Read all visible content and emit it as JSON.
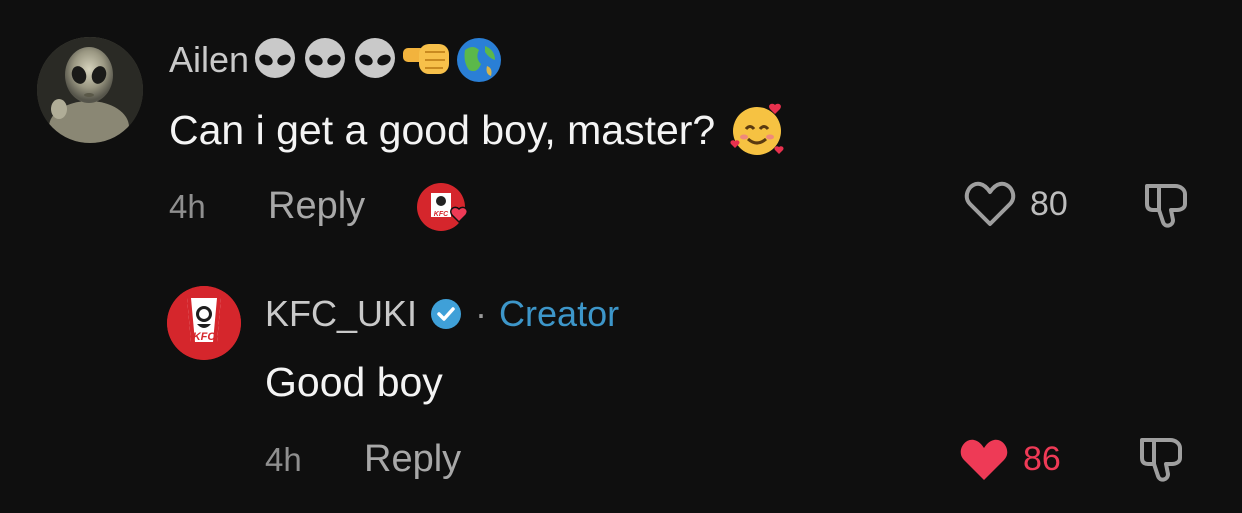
{
  "comments": [
    {
      "username": "Ailen",
      "text": "Can i get a good boy, master?",
      "time": "4h",
      "reply_label": "Reply",
      "likes": "80",
      "liked": false,
      "username_emojis": [
        "alien-emoji",
        "alien-emoji",
        "alien-emoji",
        "left-fist-emoji",
        "globe-emoji"
      ],
      "text_emoji": "smiling-face-with-hearts-emoji"
    },
    {
      "username": "KFC_UKI",
      "verified": true,
      "separator": "·",
      "badge": "Creator",
      "text": "Good boy",
      "time": "4h",
      "reply_label": "Reply",
      "likes": "86",
      "liked": true,
      "avatar_logo_text": "KFC"
    }
  ],
  "colors": {
    "background": "#0f0f0f",
    "like_active": "#ee3a56",
    "creator": "#3d96c9",
    "kfc_red": "#d5262c",
    "verified": "#3fa0d8"
  }
}
